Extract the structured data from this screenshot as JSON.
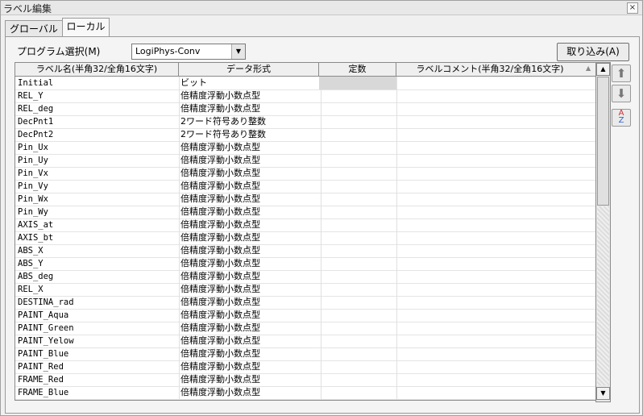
{
  "window": {
    "title": "ラベル編集",
    "close_label": "×"
  },
  "tabs": [
    {
      "label": "グローバル"
    },
    {
      "label": "ローカル"
    }
  ],
  "program": {
    "label": "プログラム選択(M)",
    "selected": "LogiPhys-Conv"
  },
  "import_button": "取り込み(A)",
  "table": {
    "headers": [
      "ラベル名(半角32/全角16文字)",
      "データ形式",
      "定数",
      "ラベルコメント(半角32/全角16文字)"
    ],
    "rows": [
      [
        "Initial",
        "ビット"
      ],
      [
        "REL_Y",
        "倍精度浮動小数点型"
      ],
      [
        "REL_deg",
        "倍精度浮動小数点型"
      ],
      [
        "DecPnt1",
        "2ワード符号あり整数"
      ],
      [
        "DecPnt2",
        "2ワード符号あり整数"
      ],
      [
        "Pin_Ux",
        "倍精度浮動小数点型"
      ],
      [
        "Pin_Uy",
        "倍精度浮動小数点型"
      ],
      [
        "Pin_Vx",
        "倍精度浮動小数点型"
      ],
      [
        "Pin_Vy",
        "倍精度浮動小数点型"
      ],
      [
        "Pin_Wx",
        "倍精度浮動小数点型"
      ],
      [
        "Pin_Wy",
        "倍精度浮動小数点型"
      ],
      [
        "AXIS_at",
        "倍精度浮動小数点型"
      ],
      [
        "AXIS_bt",
        "倍精度浮動小数点型"
      ],
      [
        "ABS_X",
        "倍精度浮動小数点型"
      ],
      [
        "ABS_Y",
        "倍精度浮動小数点型"
      ],
      [
        "ABS_deg",
        "倍精度浮動小数点型"
      ],
      [
        "REL_X",
        "倍精度浮動小数点型"
      ],
      [
        "DESTINA_rad",
        "倍精度浮動小数点型"
      ],
      [
        "PAINT_Aqua",
        "倍精度浮動小数点型"
      ],
      [
        "PAINT_Green",
        "倍精度浮動小数点型"
      ],
      [
        "PAINT_Yelow",
        "倍精度浮動小数点型"
      ],
      [
        "PAINT_Blue",
        "倍精度浮動小数点型"
      ],
      [
        "PAINT_Red",
        "倍精度浮動小数点型"
      ],
      [
        "FRAME_Red",
        "倍精度浮動小数点型"
      ],
      [
        "FRAME_Blue",
        "倍精度浮動小数点型"
      ]
    ]
  },
  "colors": {
    "header_bg": "#efefef",
    "constant_disabled": "#d8d8d8"
  }
}
